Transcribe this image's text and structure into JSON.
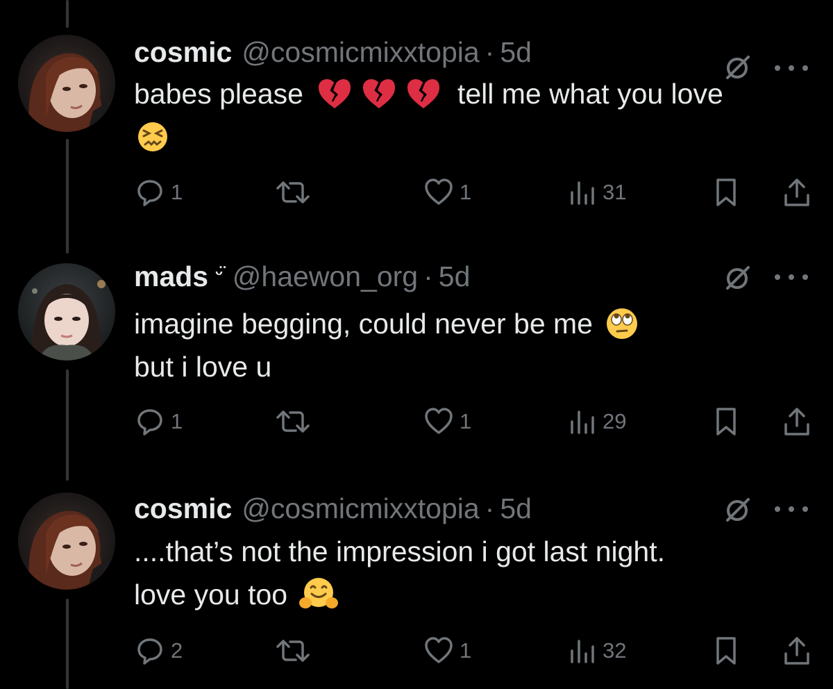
{
  "tweets": [
    {
      "name": "cosmic",
      "badge": "",
      "handle": "@cosmicmixxtopia",
      "dot": "·",
      "time": "5d",
      "lines": [
        {
          "before": "babes please",
          "emoji": [
            "broken-heart",
            "broken-heart",
            "broken-heart"
          ],
          "after": "tell me what you love"
        },
        {
          "before": "",
          "emoji": [
            "confounded-face"
          ],
          "after": ""
        }
      ],
      "replies": "1",
      "reposts": "",
      "likes": "1",
      "views": "31"
    },
    {
      "name": "mads",
      "badge": "ᵕ̈",
      "handle": "@haewon_org",
      "dot": "·",
      "time": "5d",
      "lines": [
        {
          "before": "imagine begging, could never be me",
          "emoji": [
            "eye-roll-face"
          ],
          "after": ""
        },
        {
          "before": "but i love u",
          "emoji": [],
          "after": ""
        }
      ],
      "replies": "1",
      "reposts": "",
      "likes": "1",
      "views": "29"
    },
    {
      "name": "cosmic",
      "badge": "",
      "handle": "@cosmicmixxtopia",
      "dot": "·",
      "time": "5d",
      "lines": [
        {
          "before": "....that’s not the impression i got last night.",
          "emoji": [],
          "after": ""
        },
        {
          "before": "love you too",
          "emoji": [
            "hugging-face"
          ],
          "after": ""
        }
      ],
      "replies": "2",
      "reposts": "",
      "likes": "1",
      "views": "32"
    }
  ],
  "colors": {
    "background": "#000000",
    "text": "#e7e9ea",
    "muted": "#71767b",
    "thread_line": "#333639"
  }
}
